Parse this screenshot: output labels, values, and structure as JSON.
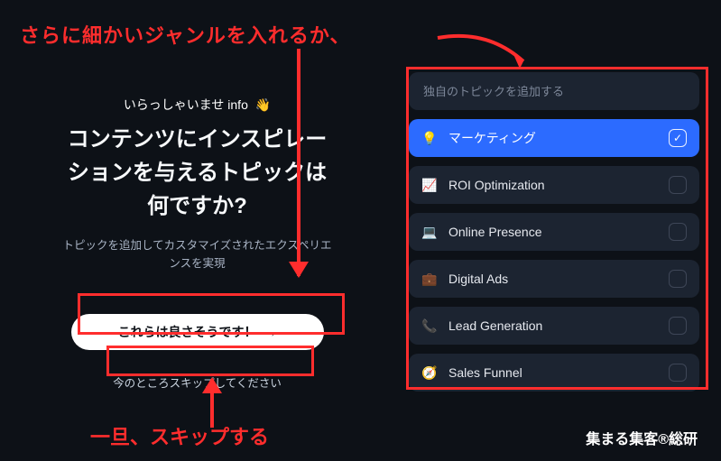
{
  "annotations": {
    "top": "さらに細かいジャンルを入れるか、",
    "bottom": "一旦、スキップする"
  },
  "brand": "集まる集客®総研",
  "left": {
    "welcome": "いらっしゃいませ info",
    "wave_emoji": "👋",
    "headline": "コンテンツにインスピレーションを与えるトピックは何ですか?",
    "subtext": "トピックを追加してカスタマイズされたエクスペリエンスを実現",
    "primary_button": "これらは良さそうです！",
    "primary_button_arrow": "→",
    "skip_button": "今のところスキップしてください"
  },
  "right": {
    "input_placeholder": "独自のトピックを追加する",
    "topics": [
      {
        "icon": "💡",
        "label": "マーケティング",
        "selected": true,
        "icon_name": "lightbulb-icon"
      },
      {
        "icon": "📈",
        "label": "ROI Optimization",
        "selected": false,
        "icon_name": "chart-icon"
      },
      {
        "icon": "💻",
        "label": "Online Presence",
        "selected": false,
        "icon_name": "laptop-icon"
      },
      {
        "icon": "💼",
        "label": "Digital Ads",
        "selected": false,
        "icon_name": "briefcase-icon"
      },
      {
        "icon": "📞",
        "label": "Lead Generation",
        "selected": false,
        "icon_name": "phone-icon"
      },
      {
        "icon": "🧭",
        "label": "Sales Funnel",
        "selected": false,
        "icon_name": "funnel-icon"
      }
    ]
  },
  "colors": {
    "accent_blue": "#2c6bff",
    "annotation_red": "#ff2d2d",
    "card_bg": "#1c2431"
  }
}
